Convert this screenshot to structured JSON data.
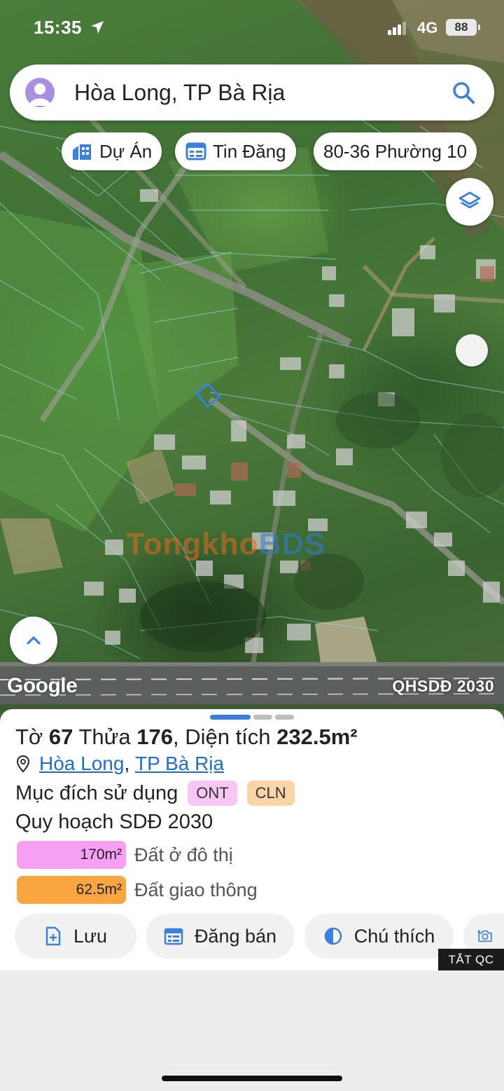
{
  "status": {
    "time": "15:35",
    "network": "4G",
    "battery": "88"
  },
  "search": {
    "query": "Hòa Long, TP Bà Rịa"
  },
  "chips": [
    {
      "label": "Dự Án",
      "icon": "building-icon"
    },
    {
      "label": "Tin Đăng",
      "icon": "listing-icon"
    },
    {
      "label": "80-36 Phường 10"
    }
  ],
  "map": {
    "watermark_a": "Tongkho",
    "watermark_b": "BDS",
    "google": "Google",
    "plan_label": "QHSDĐ 2030"
  },
  "parcel": {
    "to_label": "Tờ",
    "to": "67",
    "thua_label": "Thửa",
    "thua": "176",
    "area_label": "Diện tích",
    "area": "232.5m²",
    "ward": "Hòa Long",
    "city": "TP Bà Rịa",
    "purpose_label": "Mục đích sử dụng",
    "tags": [
      {
        "code": "ONT",
        "color": "#f8c6f4"
      },
      {
        "code": "CLN",
        "color": "#fbd4a8"
      }
    ],
    "plan_title": "Quy hoạch SDĐ 2030",
    "zones": [
      {
        "value": "170m²",
        "label": "Đất ở đô thị",
        "color": "#f79ff2",
        "fraction": 0.731
      },
      {
        "value": "62.5m²",
        "label": "Đất giao thông",
        "color": "#f7a640",
        "fraction": 0.269
      }
    ]
  },
  "actions": [
    {
      "label": "Lưu",
      "icon": "save-doc-icon"
    },
    {
      "label": "Đăng bán",
      "icon": "calendar-icon"
    },
    {
      "label": "Chú thích",
      "icon": "contrast-icon"
    },
    {
      "label": "",
      "icon": "camera-icon"
    }
  ],
  "ad_button": "TẮT QC",
  "colors": {
    "accent": "#3a80e0",
    "link": "#1d6fd1"
  }
}
